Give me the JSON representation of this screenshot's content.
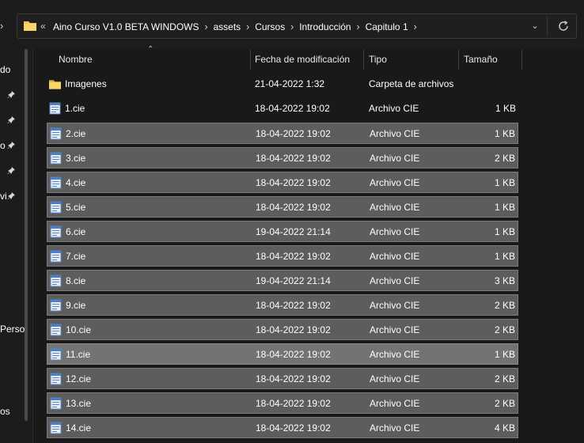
{
  "address_bar": {
    "overflow_glyph": "«",
    "breadcrumbs": [
      "Aino Curso V1.0 BETA WINDOWS",
      "assets",
      "Cursos",
      "Introducción",
      "Capitulo 1"
    ]
  },
  "nav_pane": {
    "fragments": [
      "do",
      "o",
      "vi",
      "Perso",
      "os"
    ]
  },
  "columns": {
    "name": "Nombre",
    "date": "Fecha de modificación",
    "type": "Tipo",
    "size": "Tamaño"
  },
  "files": [
    {
      "name": "Imagenes",
      "date": "21-04-2022 1:32",
      "type": "Carpeta de archivos",
      "size": "",
      "icon": "folder-icon",
      "selected": false
    },
    {
      "name": "1.cie",
      "date": "18-04-2022 19:02",
      "type": "Archivo CIE",
      "size": "1 KB",
      "icon": "file-icon",
      "selected": false
    },
    {
      "name": "2.cie",
      "date": "18-04-2022 19:02",
      "type": "Archivo CIE",
      "size": "1 KB",
      "icon": "file-icon",
      "selected": true
    },
    {
      "name": "3.cie",
      "date": "18-04-2022 19:02",
      "type": "Archivo CIE",
      "size": "2 KB",
      "icon": "file-icon",
      "selected": true
    },
    {
      "name": "4.cie",
      "date": "18-04-2022 19:02",
      "type": "Archivo CIE",
      "size": "1 KB",
      "icon": "file-icon",
      "selected": true
    },
    {
      "name": "5.cie",
      "date": "18-04-2022 19:02",
      "type": "Archivo CIE",
      "size": "1 KB",
      "icon": "file-icon",
      "selected": true
    },
    {
      "name": "6.cie",
      "date": "19-04-2022 21:14",
      "type": "Archivo CIE",
      "size": "1 KB",
      "icon": "file-icon",
      "selected": true
    },
    {
      "name": "7.cie",
      "date": "18-04-2022 19:02",
      "type": "Archivo CIE",
      "size": "1 KB",
      "icon": "file-icon",
      "selected": true
    },
    {
      "name": "8.cie",
      "date": "19-04-2022 21:14",
      "type": "Archivo CIE",
      "size": "3 KB",
      "icon": "file-icon",
      "selected": true
    },
    {
      "name": "9.cie",
      "date": "18-04-2022 19:02",
      "type": "Archivo CIE",
      "size": "2 KB",
      "icon": "file-icon",
      "selected": true
    },
    {
      "name": "10.cie",
      "date": "18-04-2022 19:02",
      "type": "Archivo CIE",
      "size": "2 KB",
      "icon": "file-icon",
      "selected": true
    },
    {
      "name": "11.cie",
      "date": "18-04-2022 19:02",
      "type": "Archivo CIE",
      "size": "1 KB",
      "icon": "file-icon",
      "selected": true,
      "hovered": true
    },
    {
      "name": "12.cie",
      "date": "18-04-2022 19:02",
      "type": "Archivo CIE",
      "size": "2 KB",
      "icon": "file-icon",
      "selected": true
    },
    {
      "name": "13.cie",
      "date": "18-04-2022 19:02",
      "type": "Archivo CIE",
      "size": "2 KB",
      "icon": "file-icon",
      "selected": true
    },
    {
      "name": "14.cie",
      "date": "18-04-2022 19:02",
      "type": "Archivo CIE",
      "size": "4 KB",
      "icon": "file-icon",
      "selected": true
    }
  ],
  "colors": {
    "background": "#191919",
    "selection": "#5d5d5d",
    "selection_hover": "#737373",
    "folder": "#f2c94c"
  }
}
